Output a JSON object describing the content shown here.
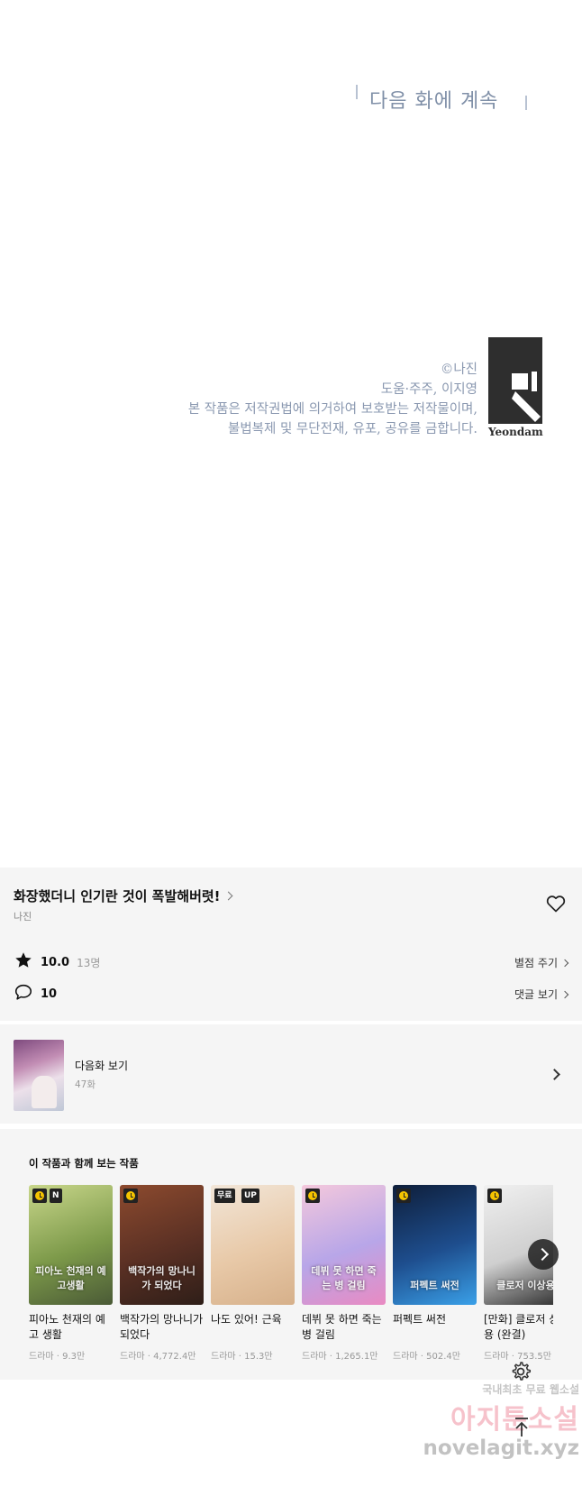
{
  "comic": {
    "to_be_continued": "다음 화에 계속",
    "copyright_lines": [
      "©나진",
      "도움·주주, 이지영",
      "본 작품은 저작권법에 의거하여 보호받는 저작물이며,",
      "불법복제 및 무단전재, 유포, 공유를 금합니다."
    ],
    "logo_text": "Yeondam"
  },
  "info": {
    "title": "화장했더니 인기란 것이 폭발해버렷!",
    "author": "나진",
    "rating": "10.0",
    "rating_count": "13명",
    "rate_link": "별점 주기",
    "comment_count": "10",
    "comment_link": "댓글 보기"
  },
  "next_episode": {
    "label": "다음화 보기",
    "episode": "47화"
  },
  "recommend": {
    "title": "이 작품과 함께 보는 작품",
    "items": [
      {
        "title": "피아노 천재의 예고 생활",
        "meta": "드라마 · 9.3만",
        "badges": [
          "N"
        ],
        "cover_text": "피아노 천재의 예고생활",
        "colors": [
          "#c8d68a",
          "#7d9a4a",
          "#4a5a36"
        ]
      },
      {
        "title": "백작가의 망나니가 되었다",
        "meta": "드라마 · 4,772.4만",
        "badges": [],
        "cover_text": "백작가의 망나니가 되었다",
        "colors": [
          "#8c4a2e",
          "#5a3024",
          "#2e1e18"
        ]
      },
      {
        "title": "나도 있어! 근육",
        "meta": "드라마 · 15.3만",
        "badges": [
          "무료",
          "UP"
        ],
        "cover_text": "",
        "colors": [
          "#f2e6d8",
          "#e8c9a8",
          "#d6b08a"
        ]
      },
      {
        "title": "데뷔 못 하면 죽는 병 걸림",
        "meta": "드라마 · 1,265.1만",
        "badges": [],
        "cover_text": "데뷔 못 하면 죽는 병 걸림",
        "colors": [
          "#f4c8dc",
          "#b8a6e8",
          "#e98ac2"
        ]
      },
      {
        "title": "퍼펙트 써전",
        "meta": "드라마 · 502.4만",
        "badges": [],
        "cover_text": "퍼펙트 써전",
        "colors": [
          "#0e1e3a",
          "#1e4e8e",
          "#3aa0e8"
        ]
      },
      {
        "title": "[만화] 클로저 상용 (완결)",
        "meta": "드라마 · 753.5만",
        "badges": [],
        "cover_text": "클로저 이상용",
        "colors": [
          "#f0f0f0",
          "#cfcfcf",
          "#2a2a2a"
        ]
      }
    ]
  },
  "watermark": {
    "line1": "국내최초 무료 웹소설",
    "line2": "아지툰소설",
    "line3": "novelagit.xyz"
  },
  "icons": [
    "heart-icon",
    "star-icon",
    "comment-icon",
    "chevron-right-icon",
    "gear-icon",
    "arrow-up-icon",
    "clock-badge-icon"
  ]
}
